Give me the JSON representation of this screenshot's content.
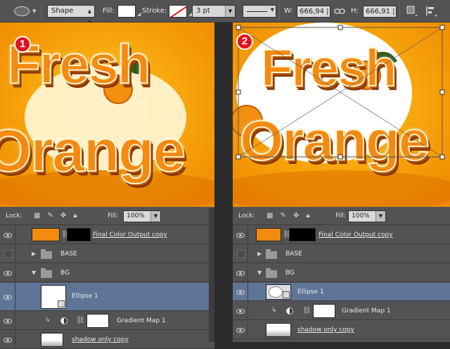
{
  "toolbar": {
    "tool_icon": "ellipse-tool-icon",
    "mode": "Shape",
    "fill_label": "Fill:",
    "stroke_label": "Stroke:",
    "stroke_size": "3 pt",
    "w_label": "W:",
    "w_value": "666,94 |",
    "h_label": "H:",
    "h_value": "666,91 |",
    "icons": [
      "path-operations-icon",
      "path-alignment-icon"
    ]
  },
  "panels": [
    {
      "badge": "1",
      "artwork_line1": "Fresh",
      "artwork_line2": "Orange",
      "lock_label": "Lock:",
      "fill_label": "Fill:",
      "fill_value": "100%",
      "layers": [
        {
          "name": "Final Color Output copy"
        },
        {
          "name": "BASE"
        },
        {
          "name": "BG"
        },
        {
          "name": "Ellipse 1"
        },
        {
          "name": "Gradient Map 1"
        },
        {
          "name": "shadow only copy"
        }
      ]
    },
    {
      "badge": "2",
      "artwork_line1": "Fresh",
      "artwork_line2": "Orange",
      "lock_label": "Lock:",
      "fill_label": "Fill:",
      "fill_value": "100%",
      "layers": [
        {
          "name": "Final Color Output copy"
        },
        {
          "name": "BASE"
        },
        {
          "name": "BG"
        },
        {
          "name": "Ellipse 1"
        },
        {
          "name": "Gradient Map 1"
        },
        {
          "name": "shadow only copy"
        }
      ]
    }
  ],
  "colors": {
    "ui_gray": "#535353",
    "selected_row": "#5f7597",
    "canvas_orange": "#f6a000",
    "badge_red": "#e4121c"
  }
}
